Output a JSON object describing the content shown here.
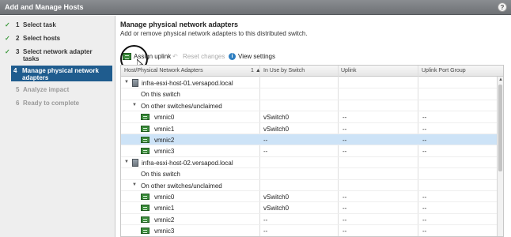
{
  "window": {
    "title": "Add and Manage Hosts",
    "help_glyph": "?"
  },
  "steps": [
    {
      "num": "1",
      "label": "Select task",
      "state": "done"
    },
    {
      "num": "2",
      "label": "Select hosts",
      "state": "done"
    },
    {
      "num": "3",
      "label": "Select network adapter tasks",
      "state": "done"
    },
    {
      "num": "4",
      "label": "Manage physical network adapters",
      "state": "active"
    },
    {
      "num": "5",
      "label": "Analyze impact",
      "state": "disabled"
    },
    {
      "num": "6",
      "label": "Ready to complete",
      "state": "disabled"
    }
  ],
  "check_glyph": "✓",
  "main": {
    "heading": "Manage physical network adapters",
    "subtitle": "Add or remove physical network adapters to this distributed switch."
  },
  "toolbar": {
    "assign": "Assign uplink",
    "reset": "Reset changes",
    "view": "View settings"
  },
  "grid": {
    "columns": [
      "Host/Physical Network Adapters",
      "In Use by Switch",
      "Uplink",
      "Uplink Port Group"
    ],
    "sort_indicator": "1 ▲",
    "rows": [
      {
        "level": 0,
        "kind": "host",
        "name": "infra-esxi-host-01.versapod.local",
        "switch": "",
        "uplink": "",
        "pg": ""
      },
      {
        "level": 1,
        "kind": "group",
        "name": "On this switch",
        "switch": "",
        "uplink": "",
        "pg": ""
      },
      {
        "level": 1,
        "kind": "group-open",
        "name": "On other switches/unclaimed",
        "switch": "",
        "uplink": "",
        "pg": ""
      },
      {
        "level": 2,
        "kind": "nic",
        "name": "vmnic0",
        "switch": "vSwitch0",
        "uplink": "--",
        "pg": "--"
      },
      {
        "level": 2,
        "kind": "nic",
        "name": "vmnic1",
        "switch": "vSwitch0",
        "uplink": "--",
        "pg": "--"
      },
      {
        "level": 2,
        "kind": "nic",
        "name": "vmnic2",
        "switch": "--",
        "uplink": "--",
        "pg": "--",
        "selected": true
      },
      {
        "level": 2,
        "kind": "nic",
        "name": "vmnic3",
        "switch": "--",
        "uplink": "--",
        "pg": "--"
      },
      {
        "level": 0,
        "kind": "host",
        "name": "infra-esxi-host-02.versapod.local",
        "switch": "",
        "uplink": "",
        "pg": ""
      },
      {
        "level": 1,
        "kind": "group",
        "name": "On this switch",
        "switch": "",
        "uplink": "",
        "pg": ""
      },
      {
        "level": 1,
        "kind": "group-open",
        "name": "On other switches/unclaimed",
        "switch": "",
        "uplink": "",
        "pg": ""
      },
      {
        "level": 2,
        "kind": "nic",
        "name": "vmnic0",
        "switch": "vSwitch0",
        "uplink": "--",
        "pg": "--"
      },
      {
        "level": 2,
        "kind": "nic",
        "name": "vmnic1",
        "switch": "vSwitch0",
        "uplink": "--",
        "pg": "--"
      },
      {
        "level": 2,
        "kind": "nic",
        "name": "vmnic2",
        "switch": "--",
        "uplink": "--",
        "pg": "--"
      },
      {
        "level": 2,
        "kind": "nic",
        "name": "vmnic3",
        "switch": "--",
        "uplink": "--",
        "pg": "--"
      }
    ]
  },
  "colors": {
    "active_step": "#1f5c8e",
    "selected_row": "#cde3f7",
    "done_check": "#3c9a3c"
  },
  "icons": {
    "host": "server-icon",
    "nic": "network-adapter-icon",
    "info": "info-icon"
  }
}
